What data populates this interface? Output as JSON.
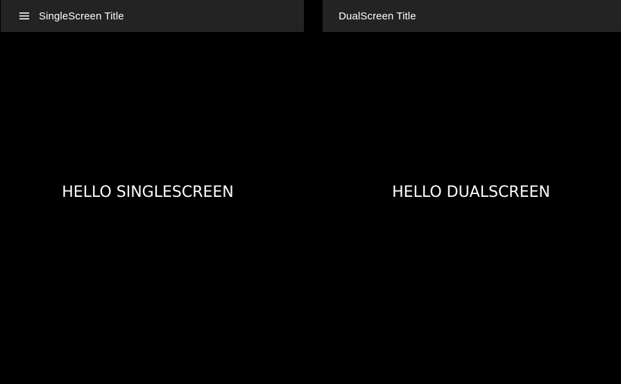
{
  "single_screen": {
    "appbar": {
      "menu_icon": "hamburger-menu-icon",
      "title": "SingleScreen Title"
    },
    "content": {
      "text": "HELLO SINGLESCREEN"
    }
  },
  "dual_screen": {
    "appbar": {
      "title": "DualScreen Title"
    },
    "content": {
      "text": "HELLO DUALSCREEN"
    }
  },
  "colors": {
    "appbar_background": "#232323",
    "page_background": "#000000",
    "text": "#ffffff"
  }
}
